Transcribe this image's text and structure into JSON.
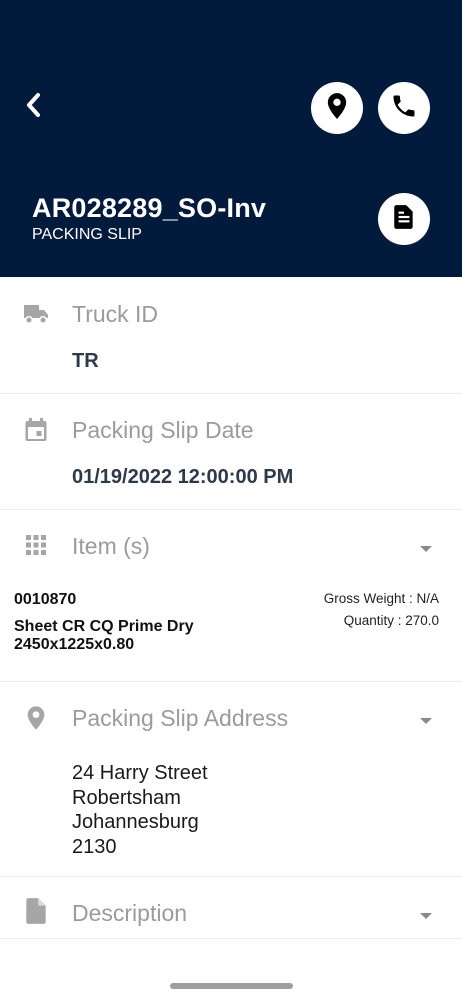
{
  "header": {
    "title": "AR028289_SO-Inv",
    "subtitle": "PACKING SLIP",
    "icons": [
      "back-icon",
      "location-pin-icon",
      "phone-icon",
      "document-icon"
    ]
  },
  "truck": {
    "label": "Truck ID",
    "value": "TR",
    "icon": "truck-icon"
  },
  "date": {
    "label": "Packing Slip Date",
    "value": "01/19/2022 12:00:00 PM",
    "icon": "calendar-icon"
  },
  "items": {
    "label": "Item (s)",
    "icon": "grid-icon",
    "list": [
      {
        "code": "0010870",
        "name": "Sheet CR CQ Prime Dry 2450x1225x0.80",
        "gross_weight": "Gross Weight : N/A",
        "quantity": "Quantity : 270.0"
      }
    ]
  },
  "address": {
    "label": "Packing Slip Address",
    "icon": "location-pin-icon",
    "lines": [
      "24 Harry Street",
      "Robertsham",
      "Johannesburg",
      "2130"
    ]
  },
  "description": {
    "label": "Description",
    "icon": "file-icon"
  },
  "colors": {
    "header_bg": "#021a3b",
    "icon_gray": "#a6a6a6",
    "label_gray": "#9b9b9b",
    "value_dark": "#2d3a4a"
  }
}
